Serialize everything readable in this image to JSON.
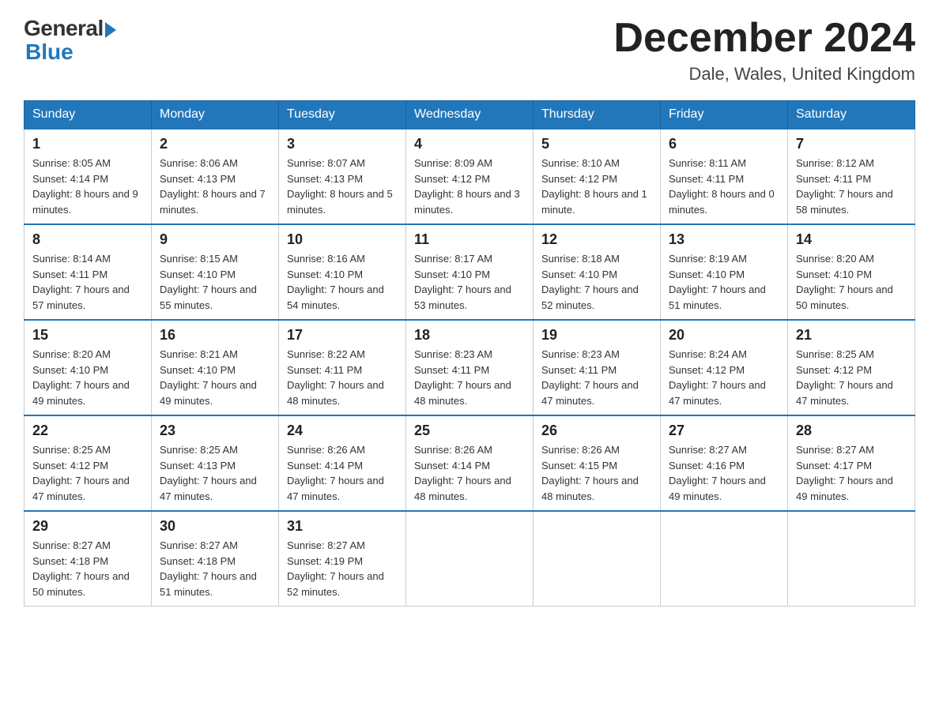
{
  "logo": {
    "general": "General",
    "blue": "Blue"
  },
  "title": {
    "month": "December 2024",
    "location": "Dale, Wales, United Kingdom"
  },
  "weekdays": [
    "Sunday",
    "Monday",
    "Tuesday",
    "Wednesday",
    "Thursday",
    "Friday",
    "Saturday"
  ],
  "weeks": [
    [
      {
        "day": "1",
        "sunrise": "8:05 AM",
        "sunset": "4:14 PM",
        "daylight": "8 hours and 9 minutes."
      },
      {
        "day": "2",
        "sunrise": "8:06 AM",
        "sunset": "4:13 PM",
        "daylight": "8 hours and 7 minutes."
      },
      {
        "day": "3",
        "sunrise": "8:07 AM",
        "sunset": "4:13 PM",
        "daylight": "8 hours and 5 minutes."
      },
      {
        "day": "4",
        "sunrise": "8:09 AM",
        "sunset": "4:12 PM",
        "daylight": "8 hours and 3 minutes."
      },
      {
        "day": "5",
        "sunrise": "8:10 AM",
        "sunset": "4:12 PM",
        "daylight": "8 hours and 1 minute."
      },
      {
        "day": "6",
        "sunrise": "8:11 AM",
        "sunset": "4:11 PM",
        "daylight": "8 hours and 0 minutes."
      },
      {
        "day": "7",
        "sunrise": "8:12 AM",
        "sunset": "4:11 PM",
        "daylight": "7 hours and 58 minutes."
      }
    ],
    [
      {
        "day": "8",
        "sunrise": "8:14 AM",
        "sunset": "4:11 PM",
        "daylight": "7 hours and 57 minutes."
      },
      {
        "day": "9",
        "sunrise": "8:15 AM",
        "sunset": "4:10 PM",
        "daylight": "7 hours and 55 minutes."
      },
      {
        "day": "10",
        "sunrise": "8:16 AM",
        "sunset": "4:10 PM",
        "daylight": "7 hours and 54 minutes."
      },
      {
        "day": "11",
        "sunrise": "8:17 AM",
        "sunset": "4:10 PM",
        "daylight": "7 hours and 53 minutes."
      },
      {
        "day": "12",
        "sunrise": "8:18 AM",
        "sunset": "4:10 PM",
        "daylight": "7 hours and 52 minutes."
      },
      {
        "day": "13",
        "sunrise": "8:19 AM",
        "sunset": "4:10 PM",
        "daylight": "7 hours and 51 minutes."
      },
      {
        "day": "14",
        "sunrise": "8:20 AM",
        "sunset": "4:10 PM",
        "daylight": "7 hours and 50 minutes."
      }
    ],
    [
      {
        "day": "15",
        "sunrise": "8:20 AM",
        "sunset": "4:10 PM",
        "daylight": "7 hours and 49 minutes."
      },
      {
        "day": "16",
        "sunrise": "8:21 AM",
        "sunset": "4:10 PM",
        "daylight": "7 hours and 49 minutes."
      },
      {
        "day": "17",
        "sunrise": "8:22 AM",
        "sunset": "4:11 PM",
        "daylight": "7 hours and 48 minutes."
      },
      {
        "day": "18",
        "sunrise": "8:23 AM",
        "sunset": "4:11 PM",
        "daylight": "7 hours and 48 minutes."
      },
      {
        "day": "19",
        "sunrise": "8:23 AM",
        "sunset": "4:11 PM",
        "daylight": "7 hours and 47 minutes."
      },
      {
        "day": "20",
        "sunrise": "8:24 AM",
        "sunset": "4:12 PM",
        "daylight": "7 hours and 47 minutes."
      },
      {
        "day": "21",
        "sunrise": "8:25 AM",
        "sunset": "4:12 PM",
        "daylight": "7 hours and 47 minutes."
      }
    ],
    [
      {
        "day": "22",
        "sunrise": "8:25 AM",
        "sunset": "4:12 PM",
        "daylight": "7 hours and 47 minutes."
      },
      {
        "day": "23",
        "sunrise": "8:25 AM",
        "sunset": "4:13 PM",
        "daylight": "7 hours and 47 minutes."
      },
      {
        "day": "24",
        "sunrise": "8:26 AM",
        "sunset": "4:14 PM",
        "daylight": "7 hours and 47 minutes."
      },
      {
        "day": "25",
        "sunrise": "8:26 AM",
        "sunset": "4:14 PM",
        "daylight": "7 hours and 48 minutes."
      },
      {
        "day": "26",
        "sunrise": "8:26 AM",
        "sunset": "4:15 PM",
        "daylight": "7 hours and 48 minutes."
      },
      {
        "day": "27",
        "sunrise": "8:27 AM",
        "sunset": "4:16 PM",
        "daylight": "7 hours and 49 minutes."
      },
      {
        "day": "28",
        "sunrise": "8:27 AM",
        "sunset": "4:17 PM",
        "daylight": "7 hours and 49 minutes."
      }
    ],
    [
      {
        "day": "29",
        "sunrise": "8:27 AM",
        "sunset": "4:18 PM",
        "daylight": "7 hours and 50 minutes."
      },
      {
        "day": "30",
        "sunrise": "8:27 AM",
        "sunset": "4:18 PM",
        "daylight": "7 hours and 51 minutes."
      },
      {
        "day": "31",
        "sunrise": "8:27 AM",
        "sunset": "4:19 PM",
        "daylight": "7 hours and 52 minutes."
      },
      null,
      null,
      null,
      null
    ]
  ],
  "labels": {
    "sunrise": "Sunrise:",
    "sunset": "Sunset:",
    "daylight": "Daylight:"
  }
}
